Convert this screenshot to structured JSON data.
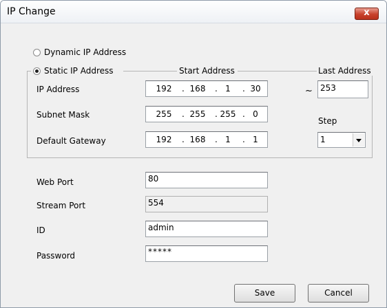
{
  "window": {
    "title": "IP Change",
    "close_glyph": "x"
  },
  "mode": {
    "dynamic_label": "Dynamic IP Address",
    "static_label": "Static IP Address",
    "selected": "static"
  },
  "group": {
    "start_header": "Start Address",
    "last_header": "Last Address"
  },
  "ip_address": {
    "label": "IP Address",
    "octets": [
      "192",
      "168",
      "1",
      "30"
    ]
  },
  "subnet_mask": {
    "label": "Subnet Mask",
    "octets": [
      "255",
      "255",
      "255",
      "0"
    ]
  },
  "gateway": {
    "label": "Default Gateway",
    "octets": [
      "192",
      "168",
      "1",
      "1"
    ]
  },
  "range": {
    "tilde": "~",
    "last_value": "253"
  },
  "step": {
    "label": "Step",
    "value": "1"
  },
  "web_port": {
    "label": "Web Port",
    "value": "80"
  },
  "stream_port": {
    "label": "Stream Port",
    "value": "554"
  },
  "id": {
    "label": "ID",
    "value": "admin"
  },
  "password": {
    "label": "Password",
    "value": "*****"
  },
  "buttons": {
    "save": "Save",
    "cancel": "Cancel"
  },
  "ip_dot": "."
}
